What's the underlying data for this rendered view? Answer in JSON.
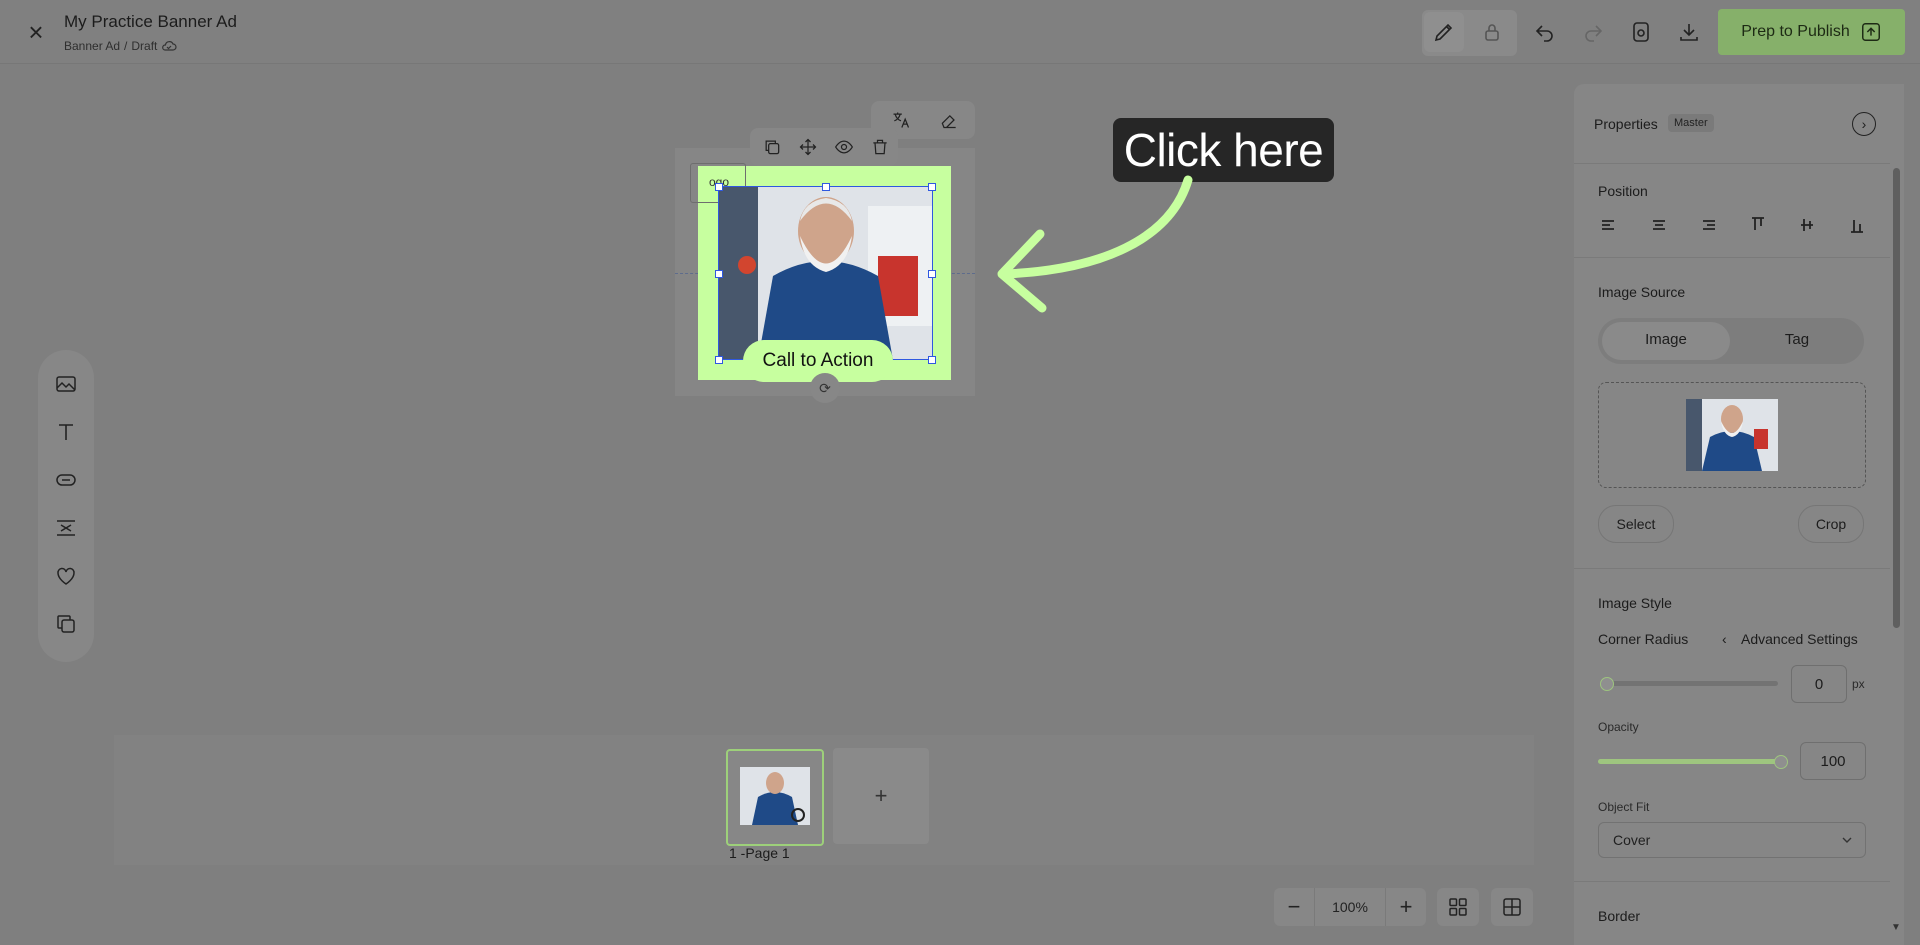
{
  "header": {
    "title": "My Practice Banner Ad",
    "breadcrumb_type": "Banner Ad",
    "breadcrumb_sep": "/",
    "breadcrumb_status": "Draft",
    "publish_label": "Prep to Publish"
  },
  "canvas": {
    "logo_text": "ogo",
    "cta_label": "Call to Action"
  },
  "annotation": {
    "label": "Click here"
  },
  "pages": {
    "items": [
      {
        "label": "1 -Page 1"
      }
    ],
    "add_label": "+"
  },
  "zoom": {
    "minus": "−",
    "value": "100%",
    "plus": "+"
  },
  "properties": {
    "title": "Properties",
    "badge": "Master",
    "position_title": "Position",
    "image_source_title": "Image Source",
    "tabs": [
      "Image",
      "Tag"
    ],
    "select_label": "Select",
    "crop_label": "Crop",
    "image_style_title": "Image Style",
    "corner_radius_label": "Corner Radius",
    "advanced_label": "Advanced Settings",
    "corner_radius_value": "0",
    "corner_radius_unit": "px",
    "opacity_label": "Opacity",
    "opacity_value": "100",
    "object_fit_label": "Object Fit",
    "object_fit_value": "Cover",
    "border_title": "Border"
  },
  "colors": {
    "accent": "#c7ff9f",
    "selection": "#2f58e0",
    "tooltip_bg": "#262626"
  },
  "icons": [
    "close-icon",
    "pencil-icon",
    "lock-icon",
    "undo-icon",
    "redo-icon",
    "preview-icon",
    "download-icon",
    "publish-icon",
    "image-icon",
    "text-icon",
    "button-icon",
    "spacer-icon",
    "heart-icon",
    "layers-icon",
    "duplicate-icon",
    "move-icon",
    "eye-icon",
    "trash-icon",
    "translate-icon",
    "eraser-icon",
    "rotate-icon",
    "grid-icon",
    "layout-icon",
    "chevron-right-icon",
    "chevron-left-icon",
    "chevron-down-icon"
  ]
}
